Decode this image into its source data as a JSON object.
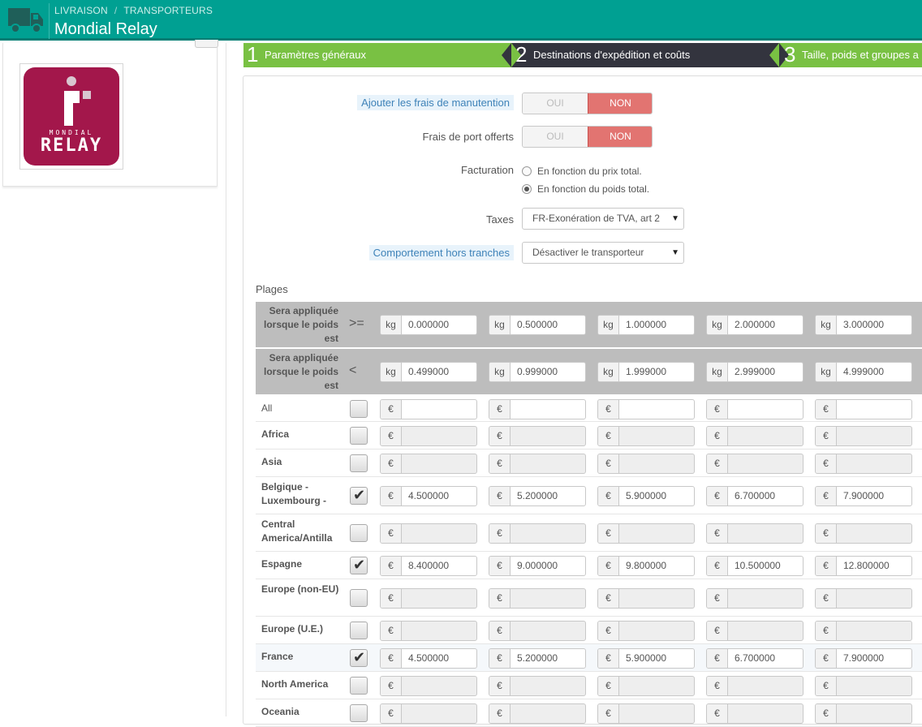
{
  "header": {
    "breadcrumb": [
      "LIVRAISON",
      "TRANSPORTEURS"
    ],
    "breadcrumb_sep": "/",
    "title": "Mondial Relay",
    "icon": "truck-icon",
    "bg_color": "#00a092"
  },
  "logo": {
    "line1": "MONDIAL",
    "line2": "RELAY",
    "color": "#a3174b"
  },
  "steps": [
    {
      "num": "1",
      "label": "Paramètres généraux",
      "color": "#79c143"
    },
    {
      "num": "2",
      "label": "Destinations d'expédition et coûts",
      "color": "#33343e"
    },
    {
      "num": "3",
      "label": "Taille, poids et groupes a",
      "color": "#79c143"
    }
  ],
  "form": {
    "handling": {
      "label": "Ajouter les frais de manutention",
      "on": "OUI",
      "off": "NON",
      "value": "NON"
    },
    "free": {
      "label": "Frais de port offerts",
      "on": "OUI",
      "off": "NON",
      "value": "NON"
    },
    "billing": {
      "label": "Facturation",
      "opt1": "En fonction du prix total.",
      "opt2": "En fonction du poids total.",
      "selected": 2
    },
    "taxes": {
      "label": "Taxes",
      "value": "FR-Exonération de TVA, art 2"
    },
    "outrange": {
      "label": "Comportement hors tranches",
      "value": "Désactiver le transporteur"
    }
  },
  "ranges": {
    "title": "Plages",
    "caption": "Sera appliquée lorsque le poids est",
    "op_from": ">=",
    "op_to": "<",
    "unit": "kg",
    "currency": "€",
    "from": [
      "0.000000",
      "0.500000",
      "1.000000",
      "2.000000",
      "3.000000"
    ],
    "to": [
      "0.499000",
      "0.999000",
      "1.999000",
      "2.999000",
      "4.999000"
    ]
  },
  "zones": [
    {
      "name": "All",
      "checked": false,
      "prices": [
        "",
        "",
        "",
        "",
        ""
      ],
      "plain": true
    },
    {
      "name": "Africa",
      "checked": false,
      "prices": [
        "",
        "",
        "",
        "",
        ""
      ]
    },
    {
      "name": "Asia",
      "checked": false,
      "prices": [
        "",
        "",
        "",
        "",
        ""
      ]
    },
    {
      "name": "Belgique - Luxembourg -",
      "checked": true,
      "prices": [
        "4.500000",
        "5.200000",
        "5.900000",
        "6.700000",
        "7.900000"
      ]
    },
    {
      "name": "Central America/Antilla",
      "checked": false,
      "prices": [
        "",
        "",
        "",
        "",
        ""
      ]
    },
    {
      "name": "Espagne",
      "checked": true,
      "prices": [
        "8.400000",
        "9.000000",
        "9.800000",
        "10.500000",
        "12.800000"
      ]
    },
    {
      "name": "Europe (non-EU)",
      "checked": false,
      "prices": [
        "",
        "",
        "",
        "",
        ""
      ]
    },
    {
      "name": "Europe (U.E.)",
      "checked": false,
      "prices": [
        "",
        "",
        "",
        "",
        ""
      ]
    },
    {
      "name": "France",
      "checked": true,
      "prices": [
        "4.500000",
        "5.200000",
        "5.900000",
        "6.700000",
        "7.900000"
      ]
    },
    {
      "name": "North America",
      "checked": false,
      "prices": [
        "",
        "",
        "",
        "",
        ""
      ]
    },
    {
      "name": "Oceania",
      "checked": false,
      "prices": [
        "",
        "",
        "",
        "",
        ""
      ]
    }
  ]
}
